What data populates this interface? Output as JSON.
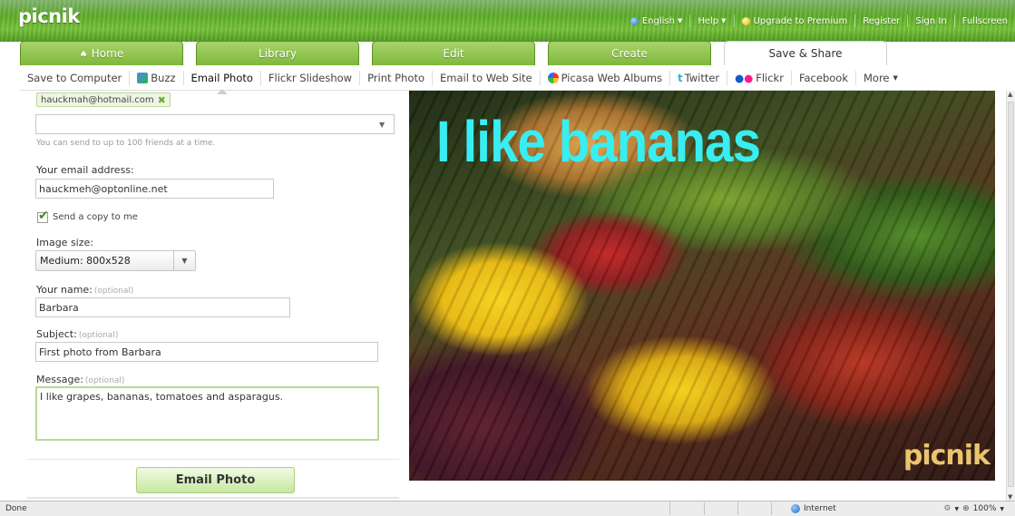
{
  "header": {
    "logo": "picnik",
    "links": [
      {
        "label": "English",
        "icon": "globe-icon"
      },
      {
        "label": "Help"
      },
      {
        "label": "Upgrade to Premium",
        "icon": "premium-icon"
      },
      {
        "label": "Register"
      },
      {
        "label": "Sign In"
      },
      {
        "label": "Fullscreen"
      }
    ]
  },
  "tabs": [
    "Home",
    "Library",
    "Edit",
    "Create",
    "Save & Share"
  ],
  "active_tab": "Save & Share",
  "subnav": [
    "Save to Computer",
    "Buzz",
    "Email Photo",
    "Flickr Slideshow",
    "Print Photo",
    "Email to Web Site",
    "Picasa Web Albums",
    "Twitter",
    "Flickr",
    "Facebook",
    "More"
  ],
  "active_subnav": "Email Photo",
  "form": {
    "recipient_chip": "hauckmah@hotmail.com",
    "recipient_input": "",
    "recipient_hint": "You can send to up to 100 friends at a time.",
    "your_email_label": "Your email address:",
    "your_email_value": "hauckmeh@optonline.net",
    "send_copy_label": "Send a copy to me",
    "send_copy_checked": true,
    "image_size_label": "Image size:",
    "image_size_value": "Medium: 800x528",
    "name_label": "Your name:",
    "name_optional": "(optional)",
    "name_value": "Barbara",
    "subject_label": "Subject:",
    "subject_optional": "(optional)",
    "subject_value": "First photo from Barbara",
    "message_label": "Message:",
    "message_optional": "(optional)",
    "message_value": "I like grapes, bananas, tomatoes and asparagus.",
    "submit_label": "Email Photo"
  },
  "photo": {
    "caption": "I like bananas",
    "watermark": "picnik",
    "caption_color": "#38eef2"
  },
  "statusbar": {
    "status": "Done",
    "zone": "Internet",
    "zoom": "100%"
  },
  "colors": {
    "brand_green": "#6aae2a",
    "header_green": "#5fb02a"
  }
}
